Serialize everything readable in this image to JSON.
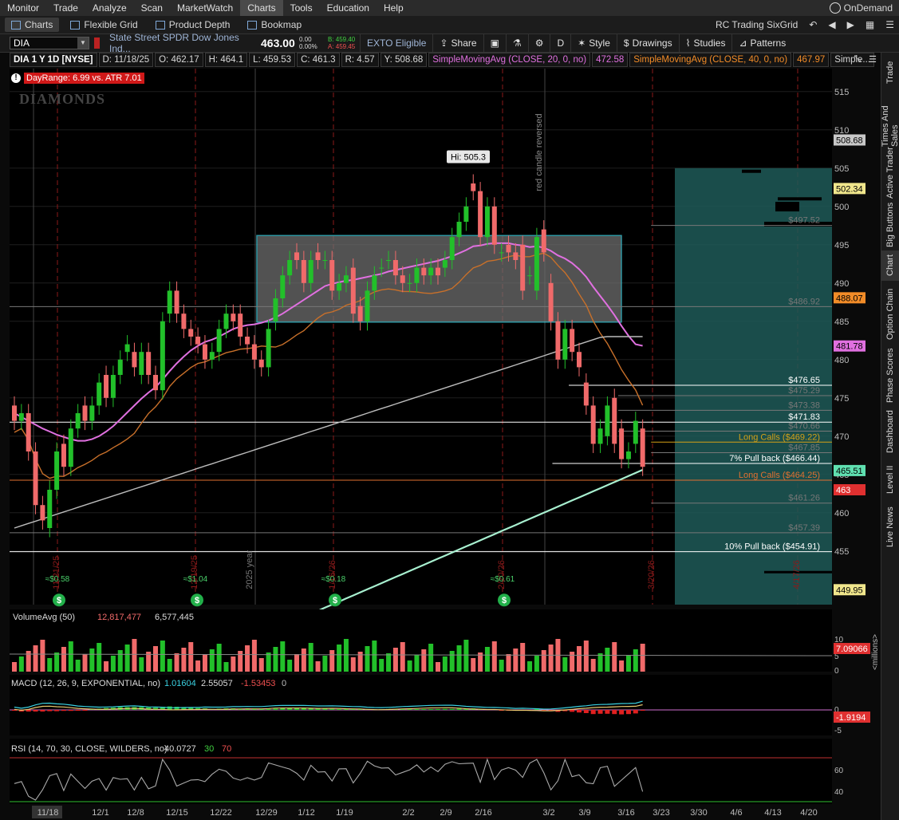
{
  "menu": [
    "Monitor",
    "Trade",
    "Analyze",
    "Scan",
    "MarketWatch",
    "Charts",
    "Tools",
    "Education",
    "Help"
  ],
  "menu_active": "Charts",
  "ondemand": "OnDemand",
  "tabs": [
    "Charts",
    "Flexible Grid",
    "Product Depth",
    "Bookmap"
  ],
  "grid_name": "RC Trading SixGrid",
  "symbol": "DIA",
  "description": "State Street SPDR Dow Jones Ind...",
  "last_price": "463.00",
  "change_top": "0.00",
  "change_pct": "0.00%",
  "bid": "B: 459.40",
  "ask": "A: 459.45",
  "exto": "EXTO Eligible",
  "toolbar": {
    "share": "Share",
    "period": "D",
    "style": "Style",
    "drawings": "Drawings",
    "studies": "Studies",
    "patterns": "Patterns"
  },
  "infobar": {
    "title": "DIA 1 Y 1D [NYSE]",
    "d": "D: 11/18/25",
    "o": "O: 462.17",
    "h": "H: 464.1",
    "l": "L: 459.53",
    "c": "C: 461.3",
    "r": "R: 4.57",
    "y": "Y: 508.68",
    "sma20": "SimpleMovingAvg (CLOSE, 20, 0, no)",
    "sma20_val": "472.58",
    "sma40": "SimpleMovingAvg (CLOSE, 40, 0, no)",
    "sma40_val": "467.97",
    "more": "Simple..."
  },
  "dayrange": "DayRange: 6.99 vs. ATR 7.01",
  "logo_text": "DIAMONDS",
  "hi_label": "Hi: 505.3",
  "annotation_vertical": "red candle reversed",
  "year_label": "2025 year",
  "price_axis": [
    515,
    510,
    505,
    500,
    495,
    490,
    485,
    480,
    475,
    470,
    465,
    460,
    455
  ],
  "right_badges": [
    {
      "text": "508.68",
      "color": "#c8c8c8",
      "fg": "#000",
      "price": 508.68
    },
    {
      "text": "502.34",
      "color": "#f0e68c",
      "fg": "#000",
      "price": 502.34
    },
    {
      "text": "488.07",
      "color": "#f28c28",
      "fg": "#000",
      "price": 488.07
    },
    {
      "text": "481.78",
      "color": "#e070e0",
      "fg": "#000",
      "price": 481.78
    },
    {
      "text": "465.51",
      "color": "#5fe0b0",
      "fg": "#000",
      "price": 465.51
    },
    {
      "text": "463",
      "color": "#e03030",
      "fg": "#fff",
      "price": 463
    },
    {
      "text": "449.95",
      "color": "#f0e68c",
      "fg": "#000",
      "price": 449.95
    }
  ],
  "levels": [
    {
      "label": "$497.52",
      "price": 497.52,
      "color": "#777",
      "x1": 0.78
    },
    {
      "label": "$486.92",
      "price": 486.92,
      "color": "#777",
      "x1": 0.0
    },
    {
      "label": "$476.65",
      "price": 476.65,
      "color": "#fff",
      "x1": 0.68
    },
    {
      "label": "$475.29",
      "price": 475.29,
      "color": "#777",
      "x1": 0.74
    },
    {
      "label": "$473.38",
      "price": 473.38,
      "color": "#777",
      "x1": 0.74
    },
    {
      "label": "$471.83",
      "price": 471.83,
      "color": "#fff",
      "x1": 0.0
    },
    {
      "label": "$470.66",
      "price": 470.66,
      "color": "#777",
      "x1": 0.74
    },
    {
      "label": "Long Calls ($469.22)",
      "price": 469.22,
      "color": "#d4a017",
      "x1": 0.78
    },
    {
      "label": "$467.85",
      "price": 467.85,
      "color": "#777",
      "x1": 0.78
    },
    {
      "label": "7% Pull back ($466.44)",
      "price": 466.44,
      "color": "#fff",
      "x1": 0.66
    },
    {
      "label": "Long Calls ($464.25)",
      "price": 464.25,
      "color": "#e07030",
      "x1": 0.0
    },
    {
      "label": "$461.26",
      "price": 461.26,
      "color": "#777",
      "x1": 0.78
    },
    {
      "label": "$457.39",
      "price": 457.39,
      "color": "#777",
      "x1": 0.0
    },
    {
      "label": "10% Pull back ($454.91)",
      "price": 454.91,
      "color": "#fff",
      "x1": 0.0
    }
  ],
  "x_labels": [
    "11/18",
    "12/1",
    "12/8",
    "12/15",
    "12/22",
    "12/29",
    "1/12",
    "1/19",
    "2/2",
    "2/9",
    "2/16",
    "3/2",
    "3/9",
    "3/16",
    "3/23",
    "3/30",
    "4/6",
    "4/13",
    "4/20"
  ],
  "dividends": [
    {
      "label": "≈$0.58"
    },
    {
      "label": "≈$1.04"
    },
    {
      "label": "≈$0.18"
    },
    {
      "label": "≈$0.61"
    }
  ],
  "event_dates": [
    "11/21/25",
    "12/19/25",
    "1/16/26",
    "2/20/26",
    "3/20/26",
    "4/17/26"
  ],
  "volume": {
    "label": "VolumeAvg (50)",
    "v1": "12,817,477",
    "v2": "6,577,445",
    "badge": "7.09066",
    "axis": [
      "10",
      "5",
      "0"
    ],
    "unit": "<millions>"
  },
  "macd": {
    "label": "MACD (12, 26, 9, EXPONENTIAL, no)",
    "v1": "1.01604",
    "v2": "2.55057",
    "v3": "-1.53453",
    "v4": "0",
    "badge": "-1.9194",
    "axis": [
      "0",
      "-5"
    ]
  },
  "rsi": {
    "label": "RSI (14, 70, 30, CLOSE, WILDERS, no)",
    "v1": "40.0727",
    "v2": "30",
    "v3": "70",
    "axis": [
      "60",
      "40"
    ]
  },
  "side_tabs": [
    "Trade",
    "Times And Sales",
    "Active Trader",
    "Big Buttons",
    "Chart",
    "Option Chain",
    "Phase Scores",
    "Dashboard",
    "Level II",
    "Live News"
  ],
  "side_active": "Chart",
  "colors": {
    "up": "#22c02a",
    "down": "#f06a6a",
    "sma20": "#e070e0",
    "sma40": "#c8702a",
    "sma100": "#bcbcbc",
    "sma200": "#a8f0d0",
    "teal": "#1e5a58"
  },
  "chart_data": {
    "type": "candlestick",
    "closes": [
      472,
      473,
      468,
      461,
      459,
      463,
      468,
      466,
      471,
      473,
      472,
      474,
      477,
      475,
      478,
      480,
      482,
      479,
      481,
      478,
      476,
      485,
      489,
      486,
      484,
      483,
      482,
      480,
      481,
      484,
      486,
      485,
      483,
      482,
      480,
      479,
      484,
      488,
      491,
      493,
      493,
      490,
      493,
      493,
      493,
      489,
      490,
      491,
      486,
      485,
      489,
      491,
      492,
      493,
      491,
      490,
      490,
      492,
      491,
      492,
      491,
      493,
      496,
      498,
      500,
      502,
      496,
      500,
      495,
      494,
      494,
      493,
      489,
      491,
      496,
      494,
      485,
      480,
      484,
      481,
      479,
      474,
      469,
      471,
      474,
      469,
      467,
      468,
      472,
      466
    ],
    "opens": [
      474,
      472,
      473,
      468,
      461,
      458,
      463,
      469,
      466,
      471,
      474,
      472,
      474,
      478,
      475,
      478,
      481,
      481,
      478,
      481,
      478,
      476,
      486,
      489,
      486,
      484,
      483,
      482,
      480,
      481,
      484,
      486,
      486,
      483,
      482,
      480,
      479,
      485,
      488,
      491,
      494,
      493,
      490,
      494,
      493,
      493,
      489,
      490,
      492,
      487,
      485,
      489,
      492,
      493,
      493,
      491,
      490,
      490,
      492,
      491,
      492,
      492,
      493,
      496,
      498,
      503,
      502,
      496,
      500,
      494,
      495,
      494,
      495,
      491,
      489,
      497,
      490,
      485,
      480,
      484,
      481,
      477,
      474,
      469,
      470,
      475,
      471,
      467,
      469,
      471
    ],
    "sma20": [
      473,
      472.5,
      472,
      471.5,
      471,
      470.6,
      470.2,
      469.9,
      469.6,
      469.4,
      469.4,
      469.6,
      470,
      470.6,
      471.3,
      472.2,
      473.1,
      474,
      474.9,
      475.7,
      476.4,
      477.4,
      478.5,
      479.5,
      480.4,
      481.2,
      481.8,
      482.3,
      482.6,
      483,
      483.5,
      484,
      484.3,
      484.5,
      484.6,
      484.8,
      485.1,
      485.5,
      486,
      486.6,
      487.2,
      487.8,
      488.4,
      489,
      489.6,
      489.9,
      490.1,
      490.3,
      490.4,
      490.6,
      490.8,
      491,
      491.2,
      491.5,
      491.7,
      491.9,
      492.1,
      492.3,
      492.5,
      492.7,
      492.9,
      493.2,
      493.5,
      493.9,
      494.3,
      494.8,
      494.9,
      495.1,
      495.2,
      495.2,
      495.2,
      495,
      494.9,
      494.7,
      494.8,
      494.6,
      494.2,
      493.6,
      493.2,
      492.6,
      491.8,
      490.8,
      489.5,
      488.3,
      487.1,
      485.8,
      484.4,
      483.1,
      482,
      481.8
    ],
    "ylim": [
      448,
      518
    ],
    "annotations": [
      "Hi: 505.3",
      "red candle reversed"
    ]
  }
}
